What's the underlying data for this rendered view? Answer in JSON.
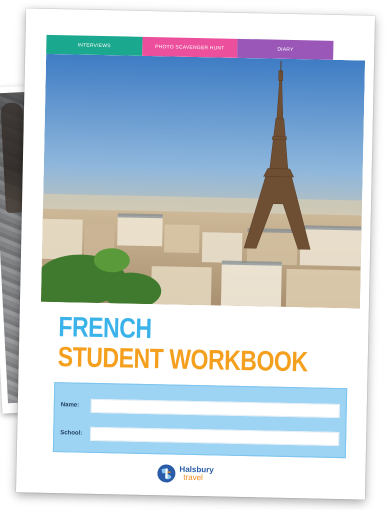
{
  "tabs": [
    "INTERVIEWS",
    "PHOTO SCAVENGER HUNT",
    "DIARY"
  ],
  "title": {
    "line1": "FRENCH",
    "line2": "STUDENT WORKBOOK"
  },
  "form": {
    "name_label": "Name:",
    "school_label": "School:"
  },
  "logo": {
    "line1": "Halsbury",
    "line2": "travel"
  },
  "colors": {
    "tab_interviews": "#1aa88e",
    "tab_photo": "#ec4f9c",
    "tab_diary": "#9a57b8",
    "title_blue": "#3ab2ea",
    "title_orange": "#f4a01e",
    "form_bg": "#9dd4f4"
  }
}
